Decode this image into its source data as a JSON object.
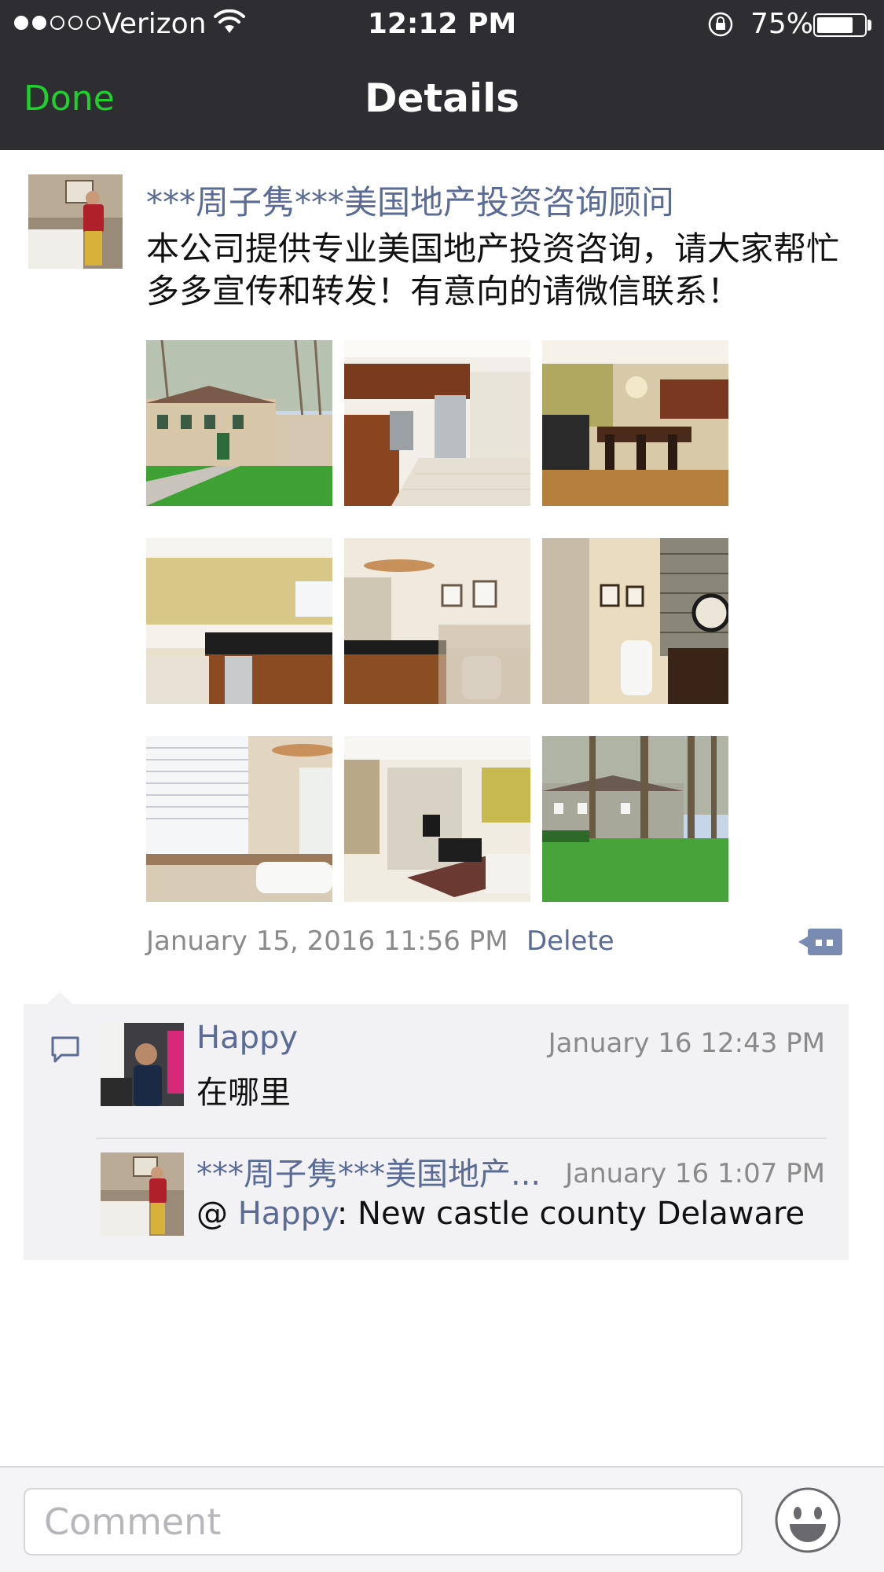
{
  "status_bar": {
    "carrier": "Verizon",
    "time": "12:12 PM",
    "battery": "75%",
    "battery_level": 0.75,
    "signal_bars": 2,
    "icons": [
      "signal-dots-icon",
      "wifi-icon",
      "rotation-lock-icon",
      "battery-icon"
    ]
  },
  "nav": {
    "done_label": "Done",
    "title": "Details"
  },
  "post": {
    "author": "***周子隽***美国地产投资咨询顾问",
    "text": "本公司提供专业美国地产投资咨询，请大家帮忙多多宣传和转发！有意向的请微信联系！",
    "photos": [
      "house-exterior-front",
      "kitchen-stainless-appliances",
      "dining-room-chandelier",
      "kitchen-breakfast-area",
      "bathroom-vanity",
      "bathroom-stone-wall",
      "bathroom-window",
      "living-room-fireplace",
      "house-exterior-back"
    ],
    "timestamp": "January 15, 2016 11:56 PM",
    "delete_label": "Delete"
  },
  "comments": [
    {
      "name": "Happy",
      "time": "January 16 12:43 PM",
      "text": "在哪里"
    },
    {
      "name": "***周子隽***美国地产...",
      "time": "January 16 1:07 PM",
      "prefix": "@ ",
      "mention": "Happy",
      "text": ": New castle county Delaware"
    }
  ],
  "input": {
    "placeholder": "Comment"
  },
  "colors": {
    "nav_bg": "#2e2e32",
    "done_green": "#20d02d",
    "name_blue": "#5a6b95",
    "comment_bg": "#f2f2f5"
  }
}
